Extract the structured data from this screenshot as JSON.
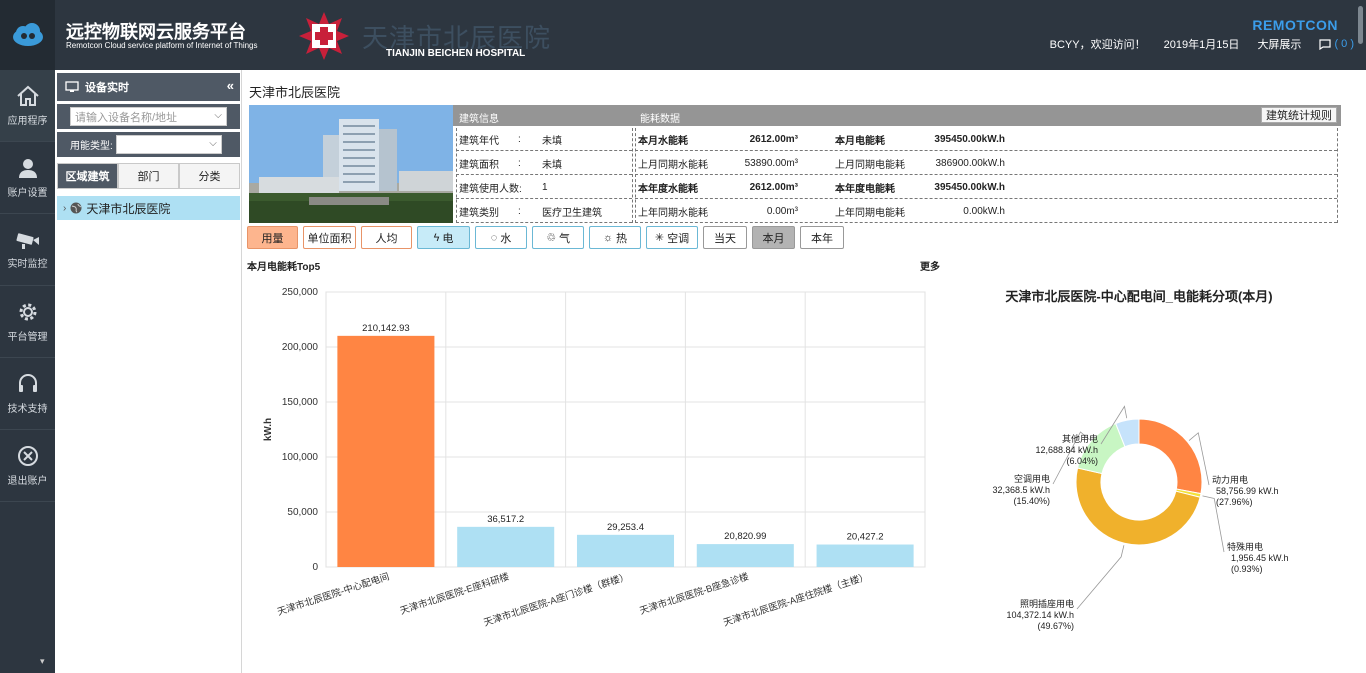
{
  "header": {
    "app_title": "远控物联网云服务平台",
    "app_subtitle": "Remotcon Cloud service platform of Internet of Things",
    "hospital_cn": "天津市北辰医院",
    "hospital_en": "TIANJIN BEICHEN HOSPITAL",
    "brand": "REMOTCON",
    "welcome": "BCYY，欢迎访问！",
    "date": "2019年1月15日",
    "big_screen": "大屏展示",
    "message_count": "( 0 )"
  },
  "nav": {
    "items": [
      {
        "label": "应用程序",
        "icon": "home-icon"
      },
      {
        "label": "账户设置",
        "icon": "user-icon"
      },
      {
        "label": "实时监控",
        "icon": "camera-icon"
      },
      {
        "label": "平台管理",
        "icon": "gear-icon"
      },
      {
        "label": "技术支持",
        "icon": "headset-icon"
      },
      {
        "label": "退出账户",
        "icon": "close-circle-icon"
      }
    ]
  },
  "panel": {
    "title": "设备实时",
    "search_placeholder": "请输入设备名称/地址",
    "energy_type_label": "用能类型:",
    "tabs": [
      "区域建筑",
      "部门",
      "分类"
    ],
    "tree_item": "天津市北辰医院"
  },
  "main": {
    "title": "天津市北辰医院",
    "building_info_header": "建筑信息",
    "energy_data_header": "能耗数据",
    "rule_button": "建筑统计规则",
    "building_rows": [
      {
        "label": "建筑年代",
        "colon": ":",
        "value": "未填"
      },
      {
        "label": "建筑面积",
        "colon": ":",
        "value": "未填"
      },
      {
        "label": "建筑使用人数:",
        "colon": "",
        "value": "1"
      },
      {
        "label": "建筑类别",
        "colon": ":",
        "value": "医疗卫生建筑"
      }
    ],
    "energy_rows": [
      {
        "l1": "本月水能耗",
        "v1": "2612.00m³",
        "l2": "本月电能耗",
        "v2": "395450.00kW.h",
        "bold": true
      },
      {
        "l1": "上月同期水能耗",
        "v1": "53890.00m³",
        "l2": "上月同期电能耗",
        "v2": "386900.00kW.h",
        "bold": false
      },
      {
        "l1": "本年度水能耗",
        "v1": "2612.00m³",
        "l2": "本年度电能耗",
        "v2": "395450.00kW.h",
        "bold": true
      },
      {
        "l1": "上年同期水能耗",
        "v1": "0.00m³",
        "l2": "上年同期电能耗",
        "v2": "0.00kW.h",
        "bold": false
      }
    ],
    "buttons": [
      {
        "label": "用量",
        "style": "orange",
        "icon": ""
      },
      {
        "label": "单位面积",
        "style": "orange-o",
        "icon": ""
      },
      {
        "label": "人均",
        "style": "orange-o",
        "icon": ""
      },
      {
        "label": "电",
        "style": "blue",
        "icon": "bolt-icon"
      },
      {
        "label": "水",
        "style": "blue-o",
        "icon": "drop-icon"
      },
      {
        "label": "气",
        "style": "blue-o",
        "icon": "gas-icon"
      },
      {
        "label": "热",
        "style": "blue-o",
        "icon": "sun-icon"
      },
      {
        "label": "空调",
        "style": "blue-o",
        "icon": "snowflake-icon"
      },
      {
        "label": "当天",
        "style": "plain",
        "icon": ""
      },
      {
        "label": "本月",
        "style": "gray",
        "icon": ""
      },
      {
        "label": "本年",
        "style": "plain",
        "icon": ""
      }
    ],
    "top5_label": "本月电能耗Top5",
    "more_label": "更多"
  },
  "chart_data": [
    {
      "type": "bar",
      "title": "本月电能耗Top5",
      "ylabel": "kW.h",
      "ylim": [
        0,
        250000
      ],
      "yticks": [
        "0",
        "50,000",
        "100,000",
        "150,000",
        "200,000",
        "250,000"
      ],
      "categories": [
        "天津市北辰医院-中心配电间",
        "天津市北辰医院-E座科研楼",
        "天津市北辰医院-A座门诊楼（群楼）",
        "天津市北辰医院-B座急诊楼",
        "天津市北辰医院-A座住院楼（主楼）"
      ],
      "values": [
        210142.93,
        36517.2,
        29253.4,
        20820.99,
        20427.2
      ],
      "value_labels": [
        "210,142.93",
        "36,517.2",
        "29,253.4",
        "20,820.99",
        "20,427.2"
      ],
      "colors": [
        "#ff8543",
        "#aee0f3",
        "#aee0f3",
        "#aee0f3",
        "#aee0f3"
      ],
      "grid": true
    },
    {
      "type": "pie",
      "title": "天津市北辰医院-中心配电间_电能耗分项(本月)",
      "slices": [
        {
          "name": "动力用电",
          "value": 58756.99,
          "value_label": "58,756.99 kW.h",
          "percent": "(27.96%)",
          "color": "#ff8543"
        },
        {
          "name": "特殊用电",
          "value": 1956.45,
          "value_label": "1,956.45 kW.h",
          "percent": "(0.93%)",
          "color": "#f3e23a"
        },
        {
          "name": "照明插座用电",
          "value": 104372.14,
          "value_label": "104,372.14 kW.h",
          "percent": "(49.67%)",
          "color": "#f0b12c"
        },
        {
          "name": "空调用电",
          "value": 32368.5,
          "value_label": "32,368.5 kW.h",
          "percent": "(15.40%)",
          "color": "#c8f6c3"
        },
        {
          "name": "其他用电",
          "value": 12688.84,
          "value_label": "12,688.84 kW.h",
          "percent": "(6.04%)",
          "color": "#c6e3fb"
        }
      ]
    }
  ]
}
